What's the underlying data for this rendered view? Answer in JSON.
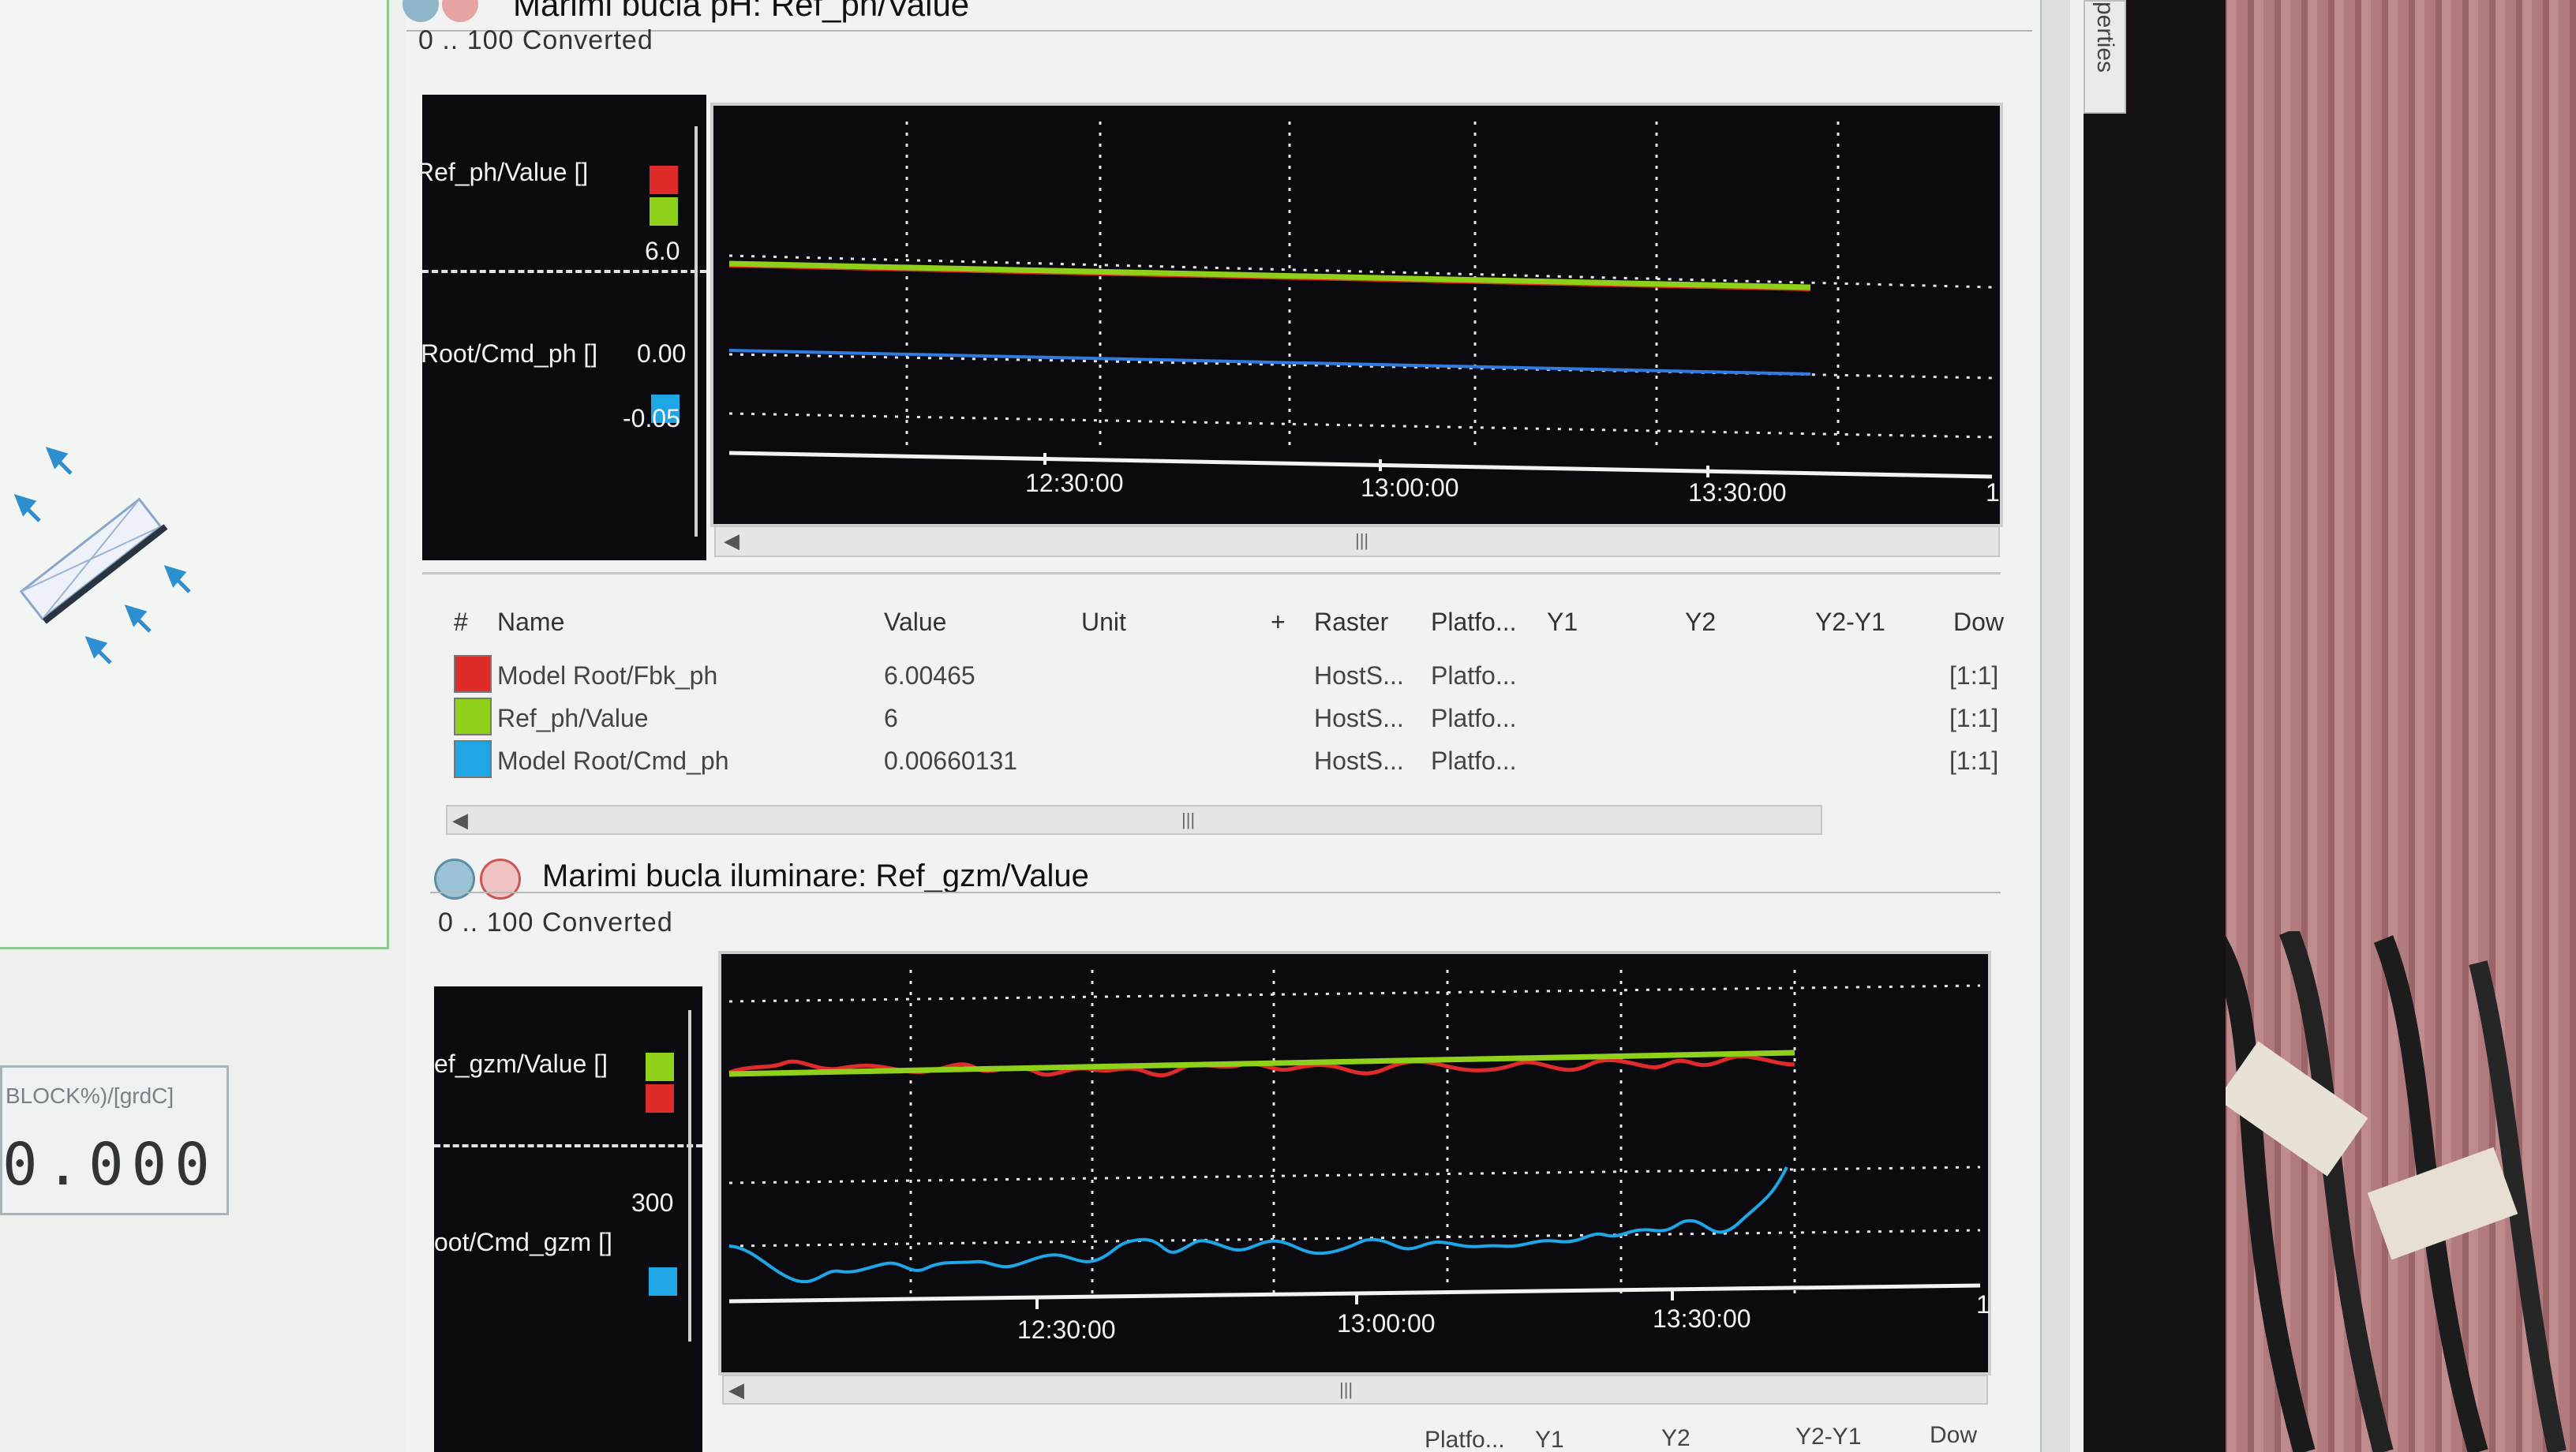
{
  "properties_tab": "perties",
  "editor": {
    "display_caption": "BLOCK%)/[grdC]",
    "display_value": "0.000"
  },
  "plot_ph": {
    "title": "Marimi bucla pH: Ref_ph/Value",
    "subtitle": "0 .. 100  Converted",
    "legend": {
      "label_ref": "Ref_ph/Value []",
      "label_cmd": "Root/Cmd_ph []",
      "tick_6": "6.0",
      "tick_0": "0.00",
      "tick_neg": "-0.05"
    },
    "time_labels": [
      "12:30:00",
      "13:00:00",
      "13:30:00"
    ],
    "axis_end_label": "1"
  },
  "table": {
    "headers": {
      "num": "#",
      "name": "Name",
      "value": "Value",
      "unit": "Unit",
      "plus": "+",
      "raster": "Raster",
      "platform": "Platfo...",
      "y1": "Y1",
      "y2": "Y2",
      "y2y1": "Y2-Y1",
      "down": "Dow"
    },
    "rows": [
      {
        "name": "Model Root/Fbk_ph",
        "value": "6.00465",
        "raster": "HostS...",
        "platform": "Platfo...",
        "down": "[1:1]",
        "color": "#e02b2b"
      },
      {
        "name": "Ref_ph/Value",
        "value": "6",
        "raster": "HostS...",
        "platform": "Platfo...",
        "down": "[1:1]",
        "color": "#8fd11a"
      },
      {
        "name": "Model Root/Cmd_ph",
        "value": "0.00660131",
        "raster": "HostS...",
        "platform": "Platfo...",
        "down": "[1:1]",
        "color": "#1ea6e6"
      }
    ]
  },
  "plot_gzm": {
    "title": "Marimi bucla iluminare: Ref_gzm/Value",
    "subtitle": "0 .. 100  Converted",
    "legend": {
      "label_ref": "ef_gzm/Value []",
      "label_cmd": "oot/Cmd_gzm []",
      "tick_300": "300"
    },
    "time_labels": [
      "12:30:00",
      "13:00:00",
      "13:30:00"
    ],
    "axis_end_label": "1"
  },
  "bottom_headers": {
    "platform": "Platfo...",
    "y1": "Y1",
    "y2": "Y2",
    "y2y1": "Y2-Y1",
    "down": "Dow"
  },
  "colors": {
    "red": "#e02b2b",
    "green": "#8fd11a",
    "blue": "#1ea6e6",
    "plot_bg": "#0b0b0f"
  }
}
